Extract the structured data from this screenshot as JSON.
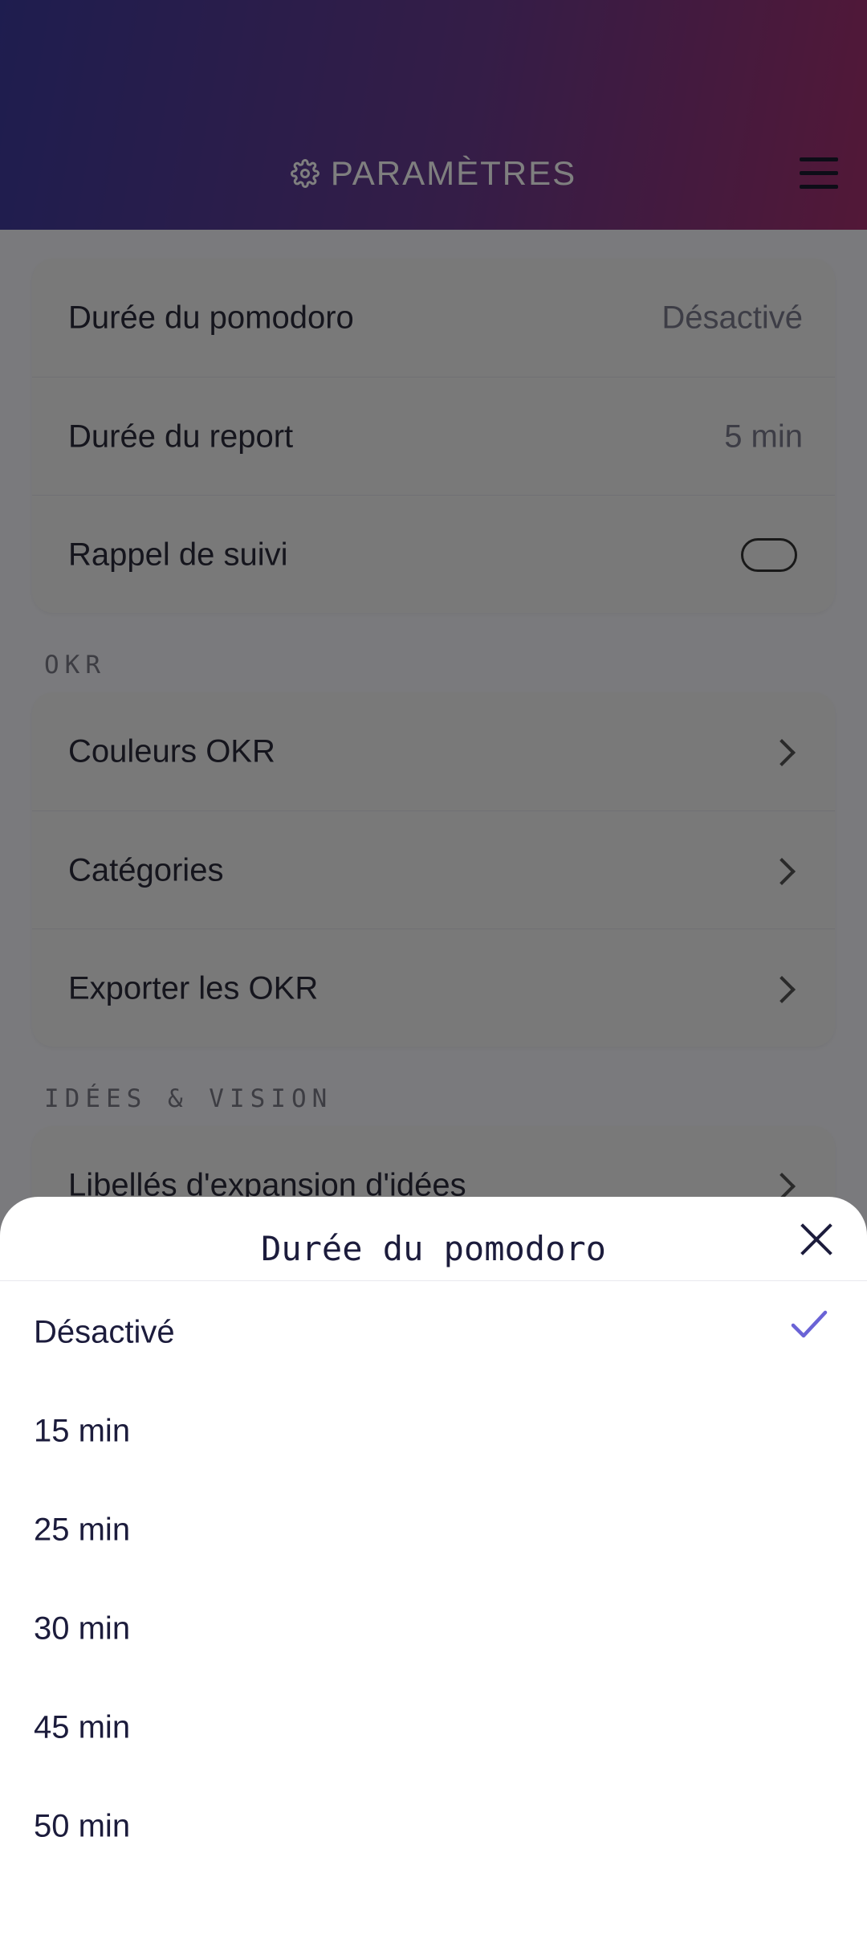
{
  "header": {
    "title": "PARAMÈTRES"
  },
  "rows_top": [
    {
      "label": "Durée du pomodoro",
      "value": "Désactivé"
    },
    {
      "label": "Durée du report",
      "value": "5 min"
    },
    {
      "label": "Rappel de suivi",
      "toggle": false
    }
  ],
  "sections": {
    "okr": {
      "label": "OKR",
      "items": [
        "Couleurs OKR",
        "Catégories",
        "Exporter les OKR"
      ]
    },
    "ideas": {
      "label": "IDÉES & VISION",
      "items": [
        "Libellés d'expansion d'idées"
      ]
    }
  },
  "sheet": {
    "title": "Durée du pomodoro",
    "options": [
      "Désactivé",
      "15 min",
      "25 min",
      "30 min",
      "45 min",
      "50 min"
    ],
    "selected": "Désactivé"
  },
  "colors": {
    "accent": "#6a63d6",
    "header_start": "#3d3a9e",
    "header_end": "#a5306f"
  }
}
